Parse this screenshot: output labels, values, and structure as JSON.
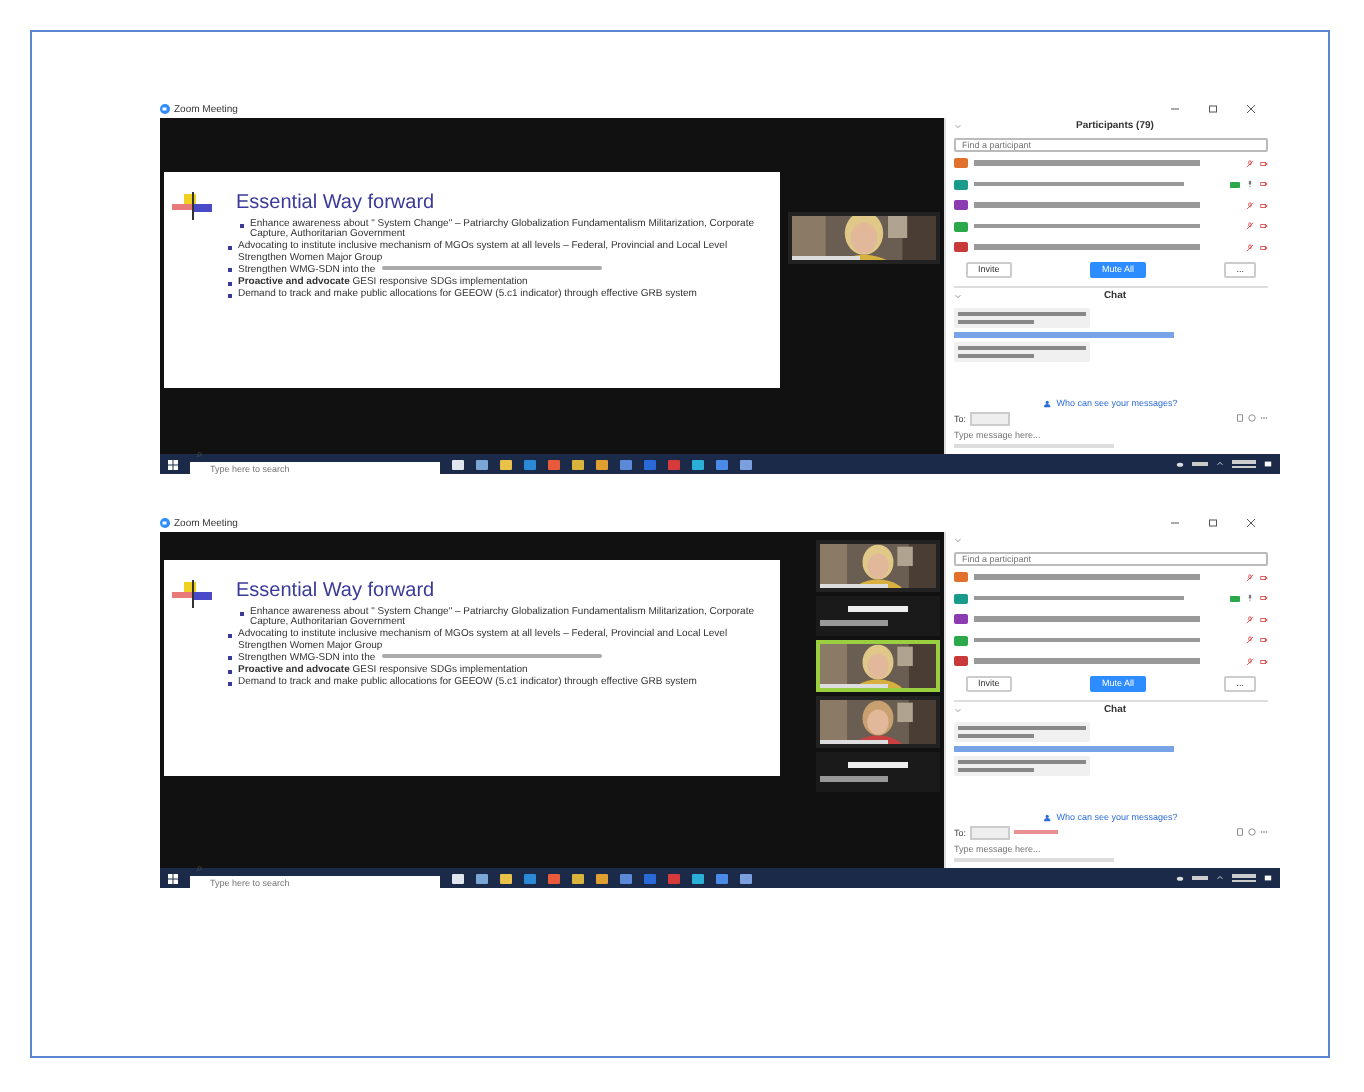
{
  "screenshots": [
    {
      "window": {
        "title": "Zoom Meeting"
      },
      "slide": {
        "title": "Essential Way forward",
        "bullets": [
          {
            "text": "Enhance awareness about \" System Change\" – Patriarchy Globalization Fundamentalism Militarization, Corporate Capture, Authoritarian Government",
            "indent": false,
            "note": false
          },
          {
            "text": " Advocating to institute inclusive mechanism of MGOs system at all levels – Federal, Provincial and Local Level Strengthen Women Major Group",
            "indent": true,
            "note": false
          },
          {
            "text": "Strengthen WMG-SDN into the",
            "indent": true,
            "note": true
          },
          {
            "text": "**Proactive and advocate** GESI responsive SDGs implementation",
            "indent": true,
            "note": false
          },
          {
            "text": "Demand to track and make public allocations for GEEOW (5.c1 indicator) through effective GRB system",
            "indent": true,
            "note": false
          }
        ]
      },
      "videos": [
        {
          "kind": "video",
          "active": false
        }
      ],
      "panel": {
        "title": "Participants (79)",
        "search": {
          "placeholder": "Find a participant"
        },
        "participants": [
          {
            "color": "#e0702a",
            "muted": true,
            "video_on": false
          },
          {
            "color": "#1a9a8a",
            "muted": false,
            "video_on": true
          },
          {
            "color": "#8a3cb0",
            "muted": true,
            "video_on": false
          },
          {
            "color": "#2aa84a",
            "muted": true,
            "video_on": false
          },
          {
            "color": "#c83a3a",
            "muted": true,
            "video_on": false
          }
        ],
        "buttons": [
          {
            "label": "Invite",
            "primary": false
          },
          {
            "label": "Mute All",
            "primary": true
          },
          {
            "label": "...",
            "primary": false
          }
        ],
        "chat_title": "Chat",
        "messages": [
          {
            "kind": "bubble"
          },
          {
            "kind": "from"
          },
          {
            "kind": "bubble"
          }
        ],
        "privacy": "Who can see your messages?",
        "to_label": "To:",
        "direct": false,
        "message": {
          "placeholder": "Type message here..."
        }
      },
      "taskbar": {
        "search": {
          "placeholder": "Type here to search"
        }
      }
    },
    {
      "window": {
        "title": "Zoom Meeting"
      },
      "slide": {
        "title": "Essential Way forward",
        "bullets": [
          {
            "text": "Enhance awareness about \" System Change\" – Patriarchy Globalization Fundamentalism Militarization, Corporate Capture, Authoritarian Government",
            "indent": false,
            "note": false
          },
          {
            "text": " Advocating to institute inclusive mechanism of MGOs system at all levels – Federal, Provincial and Local Level Strengthen Women Major Group",
            "indent": true,
            "note": false
          },
          {
            "text": "Strengthen WMG-SDN into the",
            "indent": true,
            "note": true
          },
          {
            "text": "**Proactive and advocate** GESI responsive SDGs implementation",
            "indent": true,
            "note": false
          },
          {
            "text": "Demand to track and make public allocations for GEEOW (5.c1 indicator) through effective GRB system",
            "indent": true,
            "note": false
          }
        ]
      },
      "videos": [
        {
          "kind": "video",
          "active": false
        },
        {
          "kind": "name",
          "active": false
        },
        {
          "kind": "video",
          "active": true
        },
        {
          "kind": "video",
          "active": false
        },
        {
          "kind": "name",
          "active": false
        }
      ],
      "panel": {
        "search": {
          "placeholder": "Find a participant"
        },
        "participants": [
          {
            "color": "#e0702a",
            "muted": true,
            "video_on": false
          },
          {
            "color": "#1a9a8a",
            "muted": false,
            "video_on": true
          },
          {
            "color": "#8a3cb0",
            "muted": true,
            "video_on": false
          },
          {
            "color": "#2aa84a",
            "muted": true,
            "video_on": false
          },
          {
            "color": "#c83a3a",
            "muted": true,
            "video_on": false
          }
        ],
        "buttons": [
          {
            "label": "Invite",
            "primary": false
          },
          {
            "label": "Mute All",
            "primary": true
          },
          {
            "label": "...",
            "primary": false
          }
        ],
        "chat_title": "Chat",
        "messages": [
          {
            "kind": "bubble"
          },
          {
            "kind": "from"
          },
          {
            "kind": "bubble"
          }
        ],
        "privacy": "Who can see your messages?",
        "to_label": "To:",
        "direct": true,
        "message": {
          "placeholder": "Type message here..."
        }
      },
      "taskbar": {
        "search": {
          "placeholder": "Type here to search"
        }
      }
    }
  ]
}
